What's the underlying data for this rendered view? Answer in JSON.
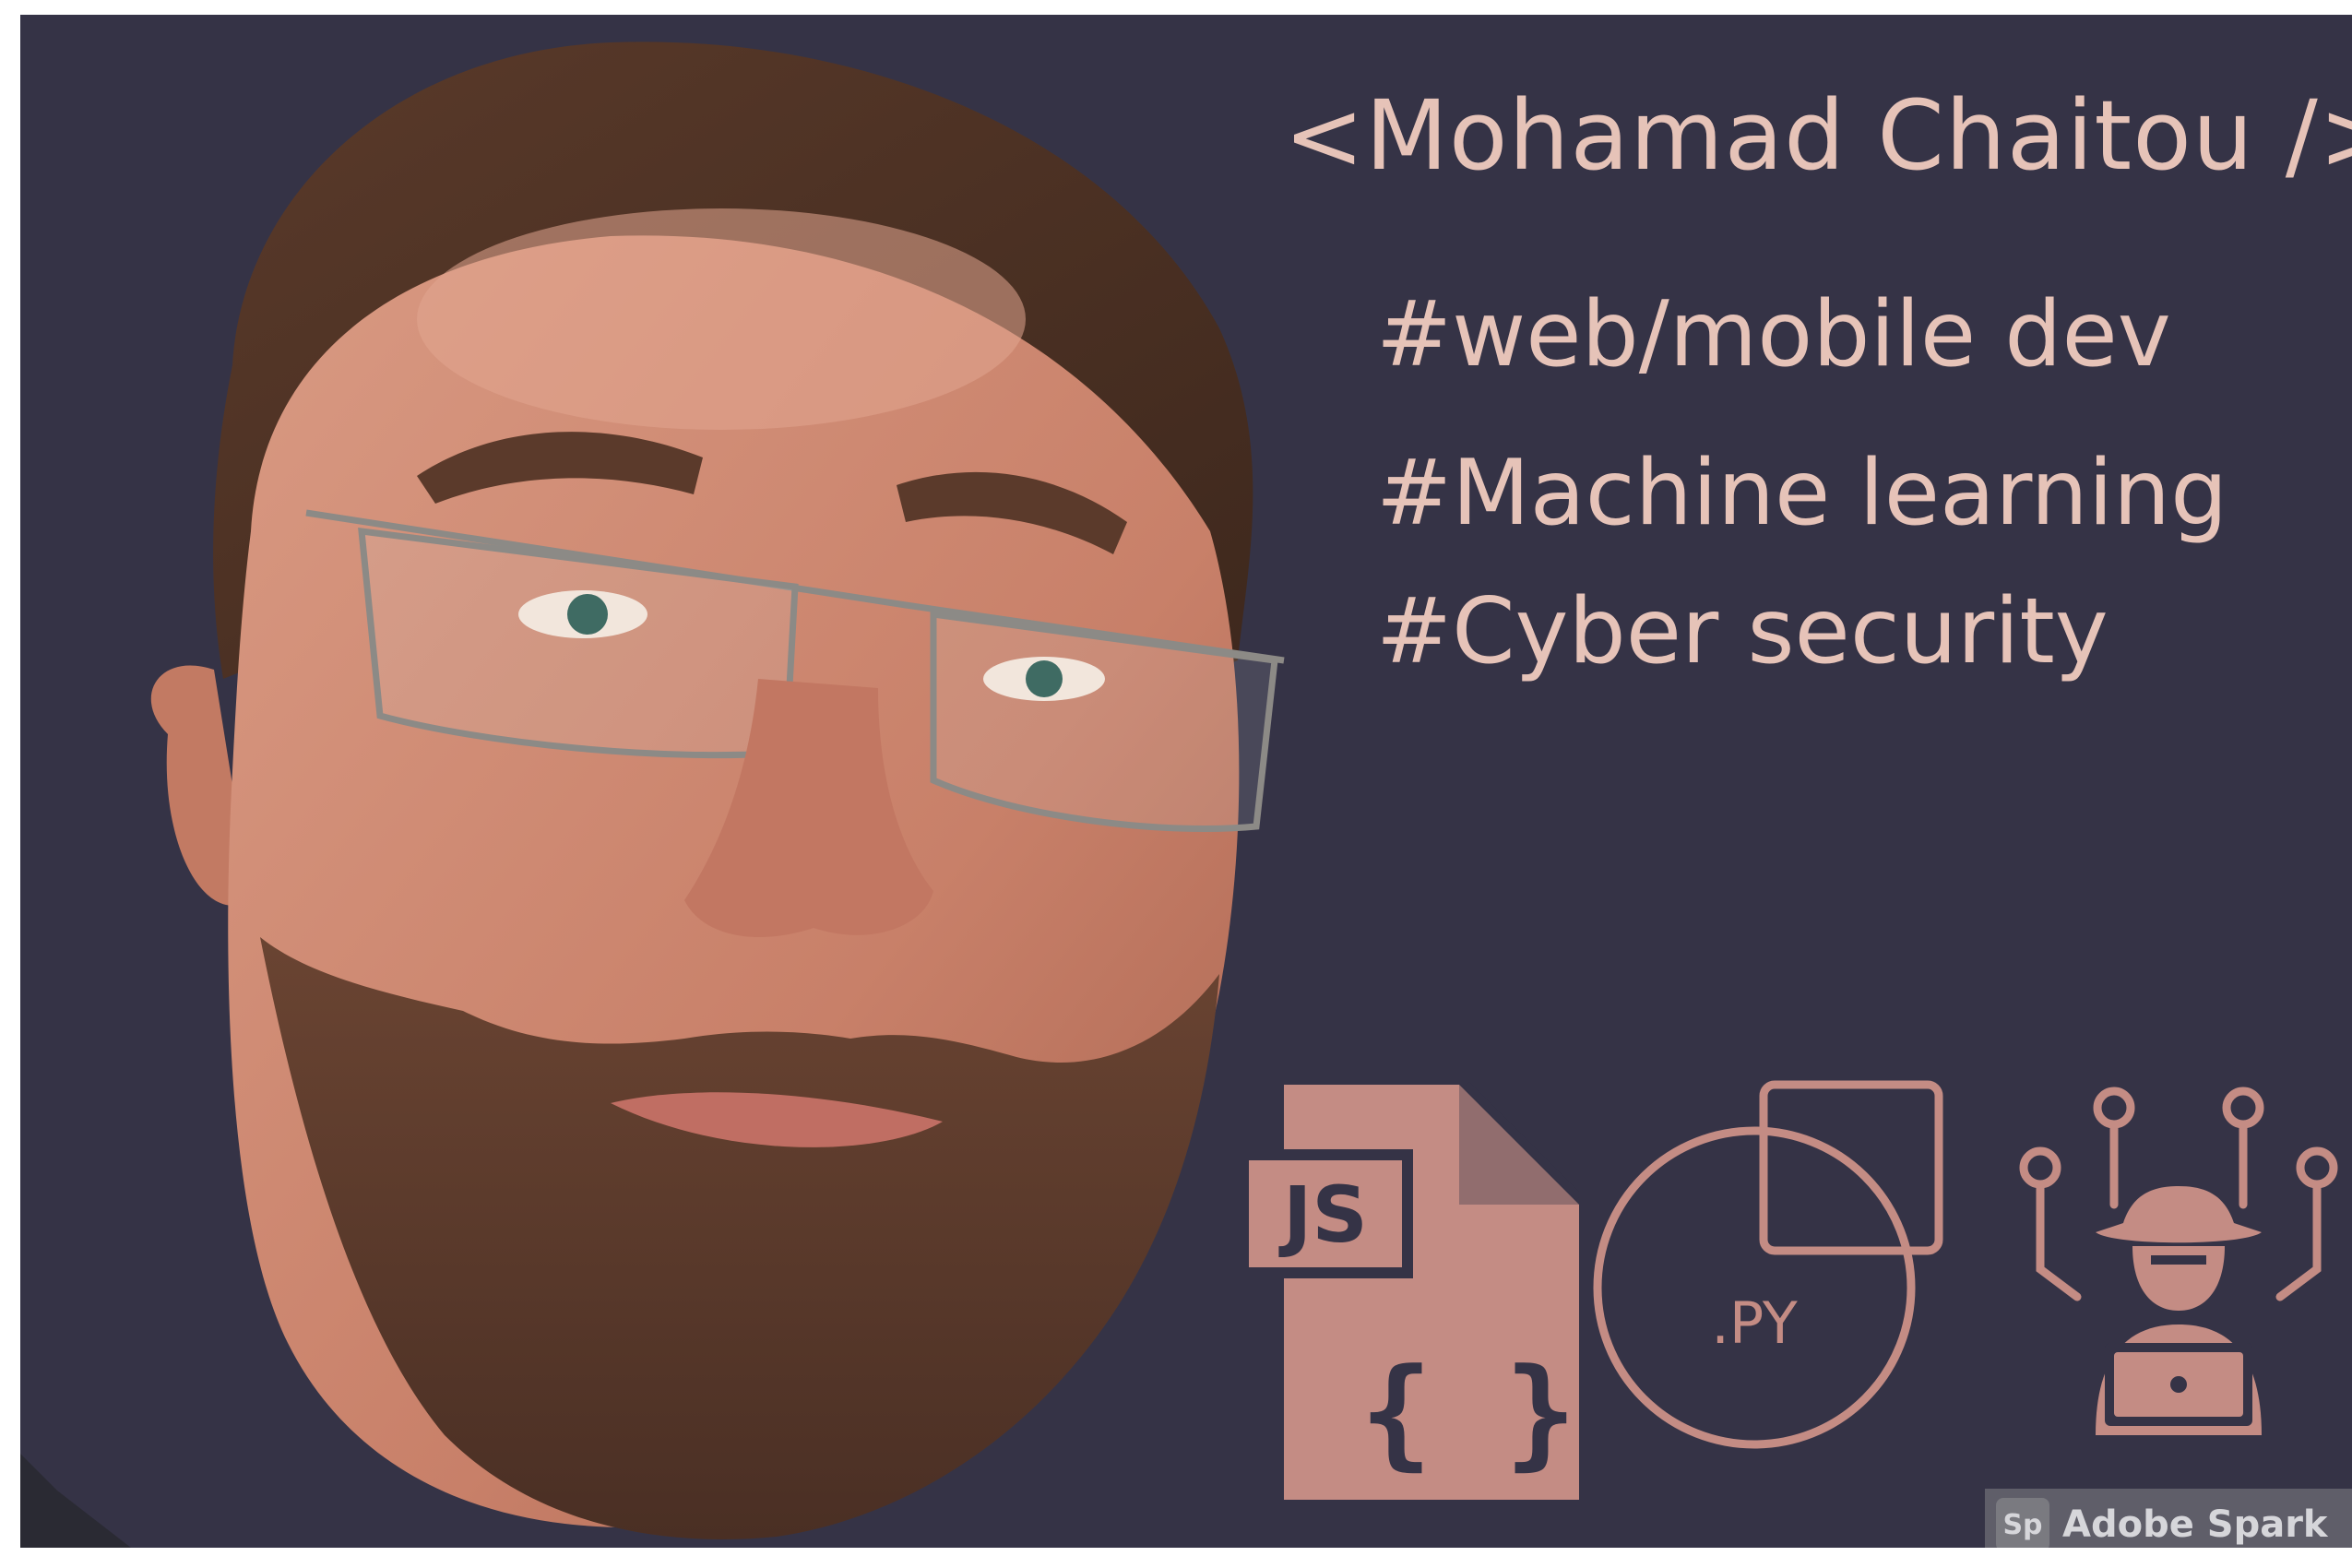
{
  "profile": {
    "name": "<Mohamad Chaitou />",
    "tags": [
      "#web/mobile dev",
      "#Machine learning",
      "#Cyber security"
    ]
  },
  "icons": {
    "js_label": "JS",
    "braces": "{ }",
    "py_label": ".PY"
  },
  "watermark": {
    "logo": "Sp",
    "text": "Adobe Spark"
  },
  "colors": {
    "background": "#353346",
    "text": "#e6c3b8",
    "icon": "#c48c84"
  }
}
